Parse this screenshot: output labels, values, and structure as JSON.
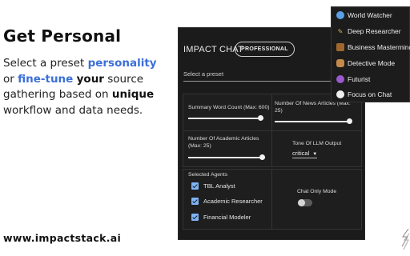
{
  "promo": {
    "headline": "Get Personal",
    "blurb": {
      "t1": "Select a preset ",
      "h1": "personality",
      "t2": " or ",
      "h2": "fine-tune",
      "t3": " ",
      "b1": "your",
      "t4": " source gathering based on ",
      "b2": "unique",
      "t5": " workflow and data needs."
    },
    "website": "www.impactstack.ai"
  },
  "app": {
    "title": "IMPACT CHAT",
    "badge": "PROFESSIONAL",
    "preset_placeholder": "Select a preset",
    "settings": {
      "summary_word_count": {
        "label": "Summary Word Count (Max: 600)",
        "value_fraction": 0.98
      },
      "news_articles": {
        "label": "Number Of News Articles (Max: 25)",
        "value_fraction": 0.98
      },
      "academic_articles": {
        "label": "Number Of Academic Articles (Max: 25)",
        "value_fraction": 0.98
      },
      "tone": {
        "label": "Tone Of LLM Output",
        "value": "critical"
      }
    },
    "agents": {
      "label": "Selected Agents",
      "items": [
        {
          "label": "TBL Analyst",
          "checked": true
        },
        {
          "label": "Academic Researcher",
          "checked": true
        },
        {
          "label": "Financial Modeler",
          "checked": true
        }
      ]
    },
    "chat_only_mode": {
      "label": "Chat Only Mode",
      "on": false
    }
  },
  "preset_menu": {
    "items": [
      {
        "label": "World Watcher",
        "icon": "globe-icon"
      },
      {
        "label": "Deep Researcher",
        "icon": "researcher-icon"
      },
      {
        "label": "Business Mastermind",
        "icon": "briefcase-icon"
      },
      {
        "label": "Detective Mode",
        "icon": "detective-icon"
      },
      {
        "label": "Futurist",
        "icon": "crystal-ball-icon"
      },
      {
        "label": "Focus on Chat",
        "icon": "speech-bubble-icon"
      }
    ]
  }
}
